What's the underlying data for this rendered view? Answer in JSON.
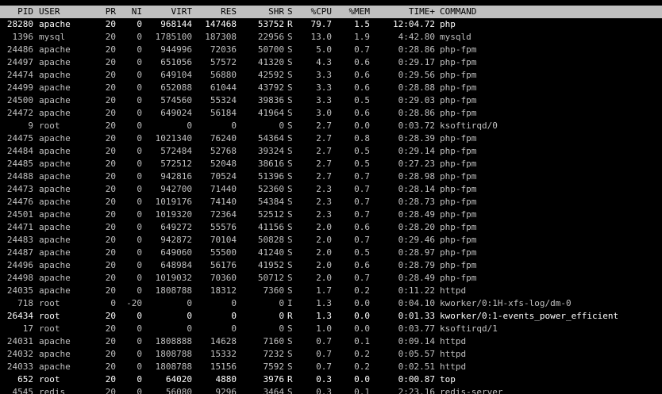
{
  "header": {
    "pid": "PID",
    "user": "USER",
    "pr": "PR",
    "ni": "NI",
    "virt": "VIRT",
    "res": "RES",
    "shr": "SHR",
    "s": "S",
    "cpu": "%CPU",
    "mem": "%MEM",
    "time": "TIME+",
    "command": "COMMAND"
  },
  "processes": [
    {
      "pid": "28280",
      "user": "apache",
      "pr": "20",
      "ni": "0",
      "virt": "968144",
      "res": "147468",
      "shr": "53752",
      "s": "R",
      "cpu": "79.7",
      "mem": "1.5",
      "time": "12:04.72",
      "command": "php",
      "bright": true
    },
    {
      "pid": "1396",
      "user": "mysql",
      "pr": "20",
      "ni": "0",
      "virt": "1785100",
      "res": "187308",
      "shr": "22956",
      "s": "S",
      "cpu": "13.0",
      "mem": "1.9",
      "time": "4:42.80",
      "command": "mysqld",
      "bright": false
    },
    {
      "pid": "24486",
      "user": "apache",
      "pr": "20",
      "ni": "0",
      "virt": "944996",
      "res": "72036",
      "shr": "50700",
      "s": "S",
      "cpu": "5.0",
      "mem": "0.7",
      "time": "0:28.86",
      "command": "php-fpm",
      "bright": false
    },
    {
      "pid": "24497",
      "user": "apache",
      "pr": "20",
      "ni": "0",
      "virt": "651056",
      "res": "57572",
      "shr": "41320",
      "s": "S",
      "cpu": "4.3",
      "mem": "0.6",
      "time": "0:29.17",
      "command": "php-fpm",
      "bright": false
    },
    {
      "pid": "24474",
      "user": "apache",
      "pr": "20",
      "ni": "0",
      "virt": "649104",
      "res": "56880",
      "shr": "42592",
      "s": "S",
      "cpu": "3.3",
      "mem": "0.6",
      "time": "0:29.56",
      "command": "php-fpm",
      "bright": false
    },
    {
      "pid": "24499",
      "user": "apache",
      "pr": "20",
      "ni": "0",
      "virt": "652088",
      "res": "61044",
      "shr": "43792",
      "s": "S",
      "cpu": "3.3",
      "mem": "0.6",
      "time": "0:28.88",
      "command": "php-fpm",
      "bright": false
    },
    {
      "pid": "24500",
      "user": "apache",
      "pr": "20",
      "ni": "0",
      "virt": "574560",
      "res": "55324",
      "shr": "39836",
      "s": "S",
      "cpu": "3.3",
      "mem": "0.5",
      "time": "0:29.03",
      "command": "php-fpm",
      "bright": false
    },
    {
      "pid": "24472",
      "user": "apache",
      "pr": "20",
      "ni": "0",
      "virt": "649024",
      "res": "56184",
      "shr": "41964",
      "s": "S",
      "cpu": "3.0",
      "mem": "0.6",
      "time": "0:28.86",
      "command": "php-fpm",
      "bright": false
    },
    {
      "pid": "9",
      "user": "root",
      "pr": "20",
      "ni": "0",
      "virt": "0",
      "res": "0",
      "shr": "0",
      "s": "S",
      "cpu": "2.7",
      "mem": "0.0",
      "time": "0:03.72",
      "command": "ksoftirqd/0",
      "bright": false
    },
    {
      "pid": "24475",
      "user": "apache",
      "pr": "20",
      "ni": "0",
      "virt": "1021340",
      "res": "76240",
      "shr": "54364",
      "s": "S",
      "cpu": "2.7",
      "mem": "0.8",
      "time": "0:28.39",
      "command": "php-fpm",
      "bright": false
    },
    {
      "pid": "24484",
      "user": "apache",
      "pr": "20",
      "ni": "0",
      "virt": "572484",
      "res": "52768",
      "shr": "39324",
      "s": "S",
      "cpu": "2.7",
      "mem": "0.5",
      "time": "0:29.14",
      "command": "php-fpm",
      "bright": false
    },
    {
      "pid": "24485",
      "user": "apache",
      "pr": "20",
      "ni": "0",
      "virt": "572512",
      "res": "52048",
      "shr": "38616",
      "s": "S",
      "cpu": "2.7",
      "mem": "0.5",
      "time": "0:27.23",
      "command": "php-fpm",
      "bright": false
    },
    {
      "pid": "24488",
      "user": "apache",
      "pr": "20",
      "ni": "0",
      "virt": "942816",
      "res": "70524",
      "shr": "51396",
      "s": "S",
      "cpu": "2.7",
      "mem": "0.7",
      "time": "0:28.98",
      "command": "php-fpm",
      "bright": false
    },
    {
      "pid": "24473",
      "user": "apache",
      "pr": "20",
      "ni": "0",
      "virt": "942700",
      "res": "71440",
      "shr": "52360",
      "s": "S",
      "cpu": "2.3",
      "mem": "0.7",
      "time": "0:28.14",
      "command": "php-fpm",
      "bright": false
    },
    {
      "pid": "24476",
      "user": "apache",
      "pr": "20",
      "ni": "0",
      "virt": "1019176",
      "res": "74140",
      "shr": "54384",
      "s": "S",
      "cpu": "2.3",
      "mem": "0.7",
      "time": "0:28.73",
      "command": "php-fpm",
      "bright": false
    },
    {
      "pid": "24501",
      "user": "apache",
      "pr": "20",
      "ni": "0",
      "virt": "1019320",
      "res": "72364",
      "shr": "52512",
      "s": "S",
      "cpu": "2.3",
      "mem": "0.7",
      "time": "0:28.49",
      "command": "php-fpm",
      "bright": false
    },
    {
      "pid": "24471",
      "user": "apache",
      "pr": "20",
      "ni": "0",
      "virt": "649272",
      "res": "55576",
      "shr": "41156",
      "s": "S",
      "cpu": "2.0",
      "mem": "0.6",
      "time": "0:28.20",
      "command": "php-fpm",
      "bright": false
    },
    {
      "pid": "24483",
      "user": "apache",
      "pr": "20",
      "ni": "0",
      "virt": "942872",
      "res": "70104",
      "shr": "50828",
      "s": "S",
      "cpu": "2.0",
      "mem": "0.7",
      "time": "0:29.46",
      "command": "php-fpm",
      "bright": false
    },
    {
      "pid": "24487",
      "user": "apache",
      "pr": "20",
      "ni": "0",
      "virt": "649060",
      "res": "55500",
      "shr": "41240",
      "s": "S",
      "cpu": "2.0",
      "mem": "0.5",
      "time": "0:28.97",
      "command": "php-fpm",
      "bright": false
    },
    {
      "pid": "24496",
      "user": "apache",
      "pr": "20",
      "ni": "0",
      "virt": "648984",
      "res": "56176",
      "shr": "41952",
      "s": "S",
      "cpu": "2.0",
      "mem": "0.6",
      "time": "0:28.79",
      "command": "php-fpm",
      "bright": false
    },
    {
      "pid": "24498",
      "user": "apache",
      "pr": "20",
      "ni": "0",
      "virt": "1019032",
      "res": "70360",
      "shr": "50712",
      "s": "S",
      "cpu": "2.0",
      "mem": "0.7",
      "time": "0:28.49",
      "command": "php-fpm",
      "bright": false
    },
    {
      "pid": "24035",
      "user": "apache",
      "pr": "20",
      "ni": "0",
      "virt": "1808788",
      "res": "18312",
      "shr": "7360",
      "s": "S",
      "cpu": "1.7",
      "mem": "0.2",
      "time": "0:11.22",
      "command": "httpd",
      "bright": false
    },
    {
      "pid": "718",
      "user": "root",
      "pr": "0",
      "ni": "-20",
      "virt": "0",
      "res": "0",
      "shr": "0",
      "s": "I",
      "cpu": "1.3",
      "mem": "0.0",
      "time": "0:04.10",
      "command": "kworker/0:1H-xfs-log/dm-0",
      "bright": false
    },
    {
      "pid": "26434",
      "user": "root",
      "pr": "20",
      "ni": "0",
      "virt": "0",
      "res": "0",
      "shr": "0",
      "s": "R",
      "cpu": "1.3",
      "mem": "0.0",
      "time": "0:01.33",
      "command": "kworker/0:1-events_power_efficient",
      "bright": true
    },
    {
      "pid": "17",
      "user": "root",
      "pr": "20",
      "ni": "0",
      "virt": "0",
      "res": "0",
      "shr": "0",
      "s": "S",
      "cpu": "1.0",
      "mem": "0.0",
      "time": "0:03.77",
      "command": "ksoftirqd/1",
      "bright": false
    },
    {
      "pid": "24031",
      "user": "apache",
      "pr": "20",
      "ni": "0",
      "virt": "1808888",
      "res": "14628",
      "shr": "7160",
      "s": "S",
      "cpu": "0.7",
      "mem": "0.1",
      "time": "0:09.14",
      "command": "httpd",
      "bright": false
    },
    {
      "pid": "24032",
      "user": "apache",
      "pr": "20",
      "ni": "0",
      "virt": "1808788",
      "res": "15332",
      "shr": "7232",
      "s": "S",
      "cpu": "0.7",
      "mem": "0.2",
      "time": "0:05.57",
      "command": "httpd",
      "bright": false
    },
    {
      "pid": "24033",
      "user": "apache",
      "pr": "20",
      "ni": "0",
      "virt": "1808788",
      "res": "15156",
      "shr": "7592",
      "s": "S",
      "cpu": "0.7",
      "mem": "0.2",
      "time": "0:02.51",
      "command": "httpd",
      "bright": false
    },
    {
      "pid": "652",
      "user": "root",
      "pr": "20",
      "ni": "0",
      "virt": "64020",
      "res": "4880",
      "shr": "3976",
      "s": "R",
      "cpu": "0.3",
      "mem": "0.0",
      "time": "0:00.87",
      "command": "top",
      "bright": true
    },
    {
      "pid": "4545",
      "user": "redis",
      "pr": "20",
      "ni": "0",
      "virt": "56080",
      "res": "9296",
      "shr": "3464",
      "s": "S",
      "cpu": "0.3",
      "mem": "0.1",
      "time": "2:23.16",
      "command": "redis-server",
      "bright": false
    }
  ]
}
